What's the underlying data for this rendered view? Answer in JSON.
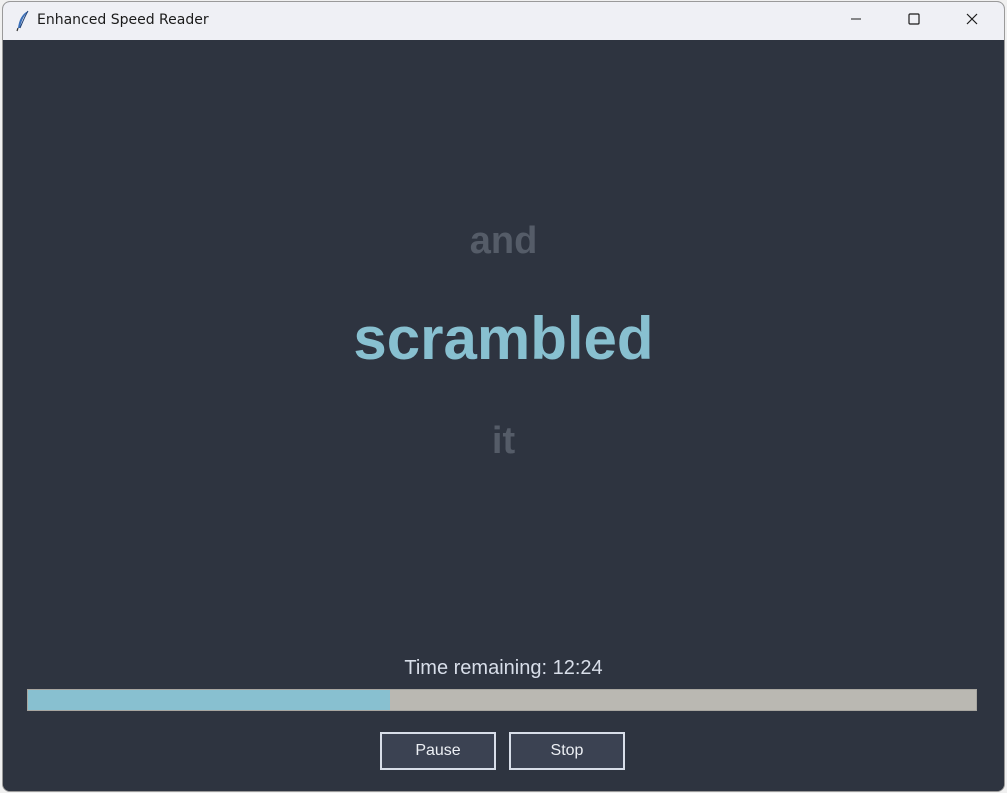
{
  "window": {
    "title": "Enhanced Speed Reader",
    "app_icon": "feather-icon",
    "controls": {
      "minimize": "minimize-icon",
      "maximize": "maximize-icon",
      "close": "close-icon"
    }
  },
  "reader": {
    "previous_word": "and",
    "current_word": "scrambled",
    "next_word": "it"
  },
  "status": {
    "time_remaining": "Time remaining: 12:24",
    "progress_fraction": 0.382
  },
  "buttons": {
    "pause_label": "Pause",
    "stop_label": "Stop"
  },
  "colors": {
    "background": "#2e3440",
    "accent": "#88c0d0",
    "dim_word": "#555c68",
    "progress_track": "#bab8b2"
  }
}
